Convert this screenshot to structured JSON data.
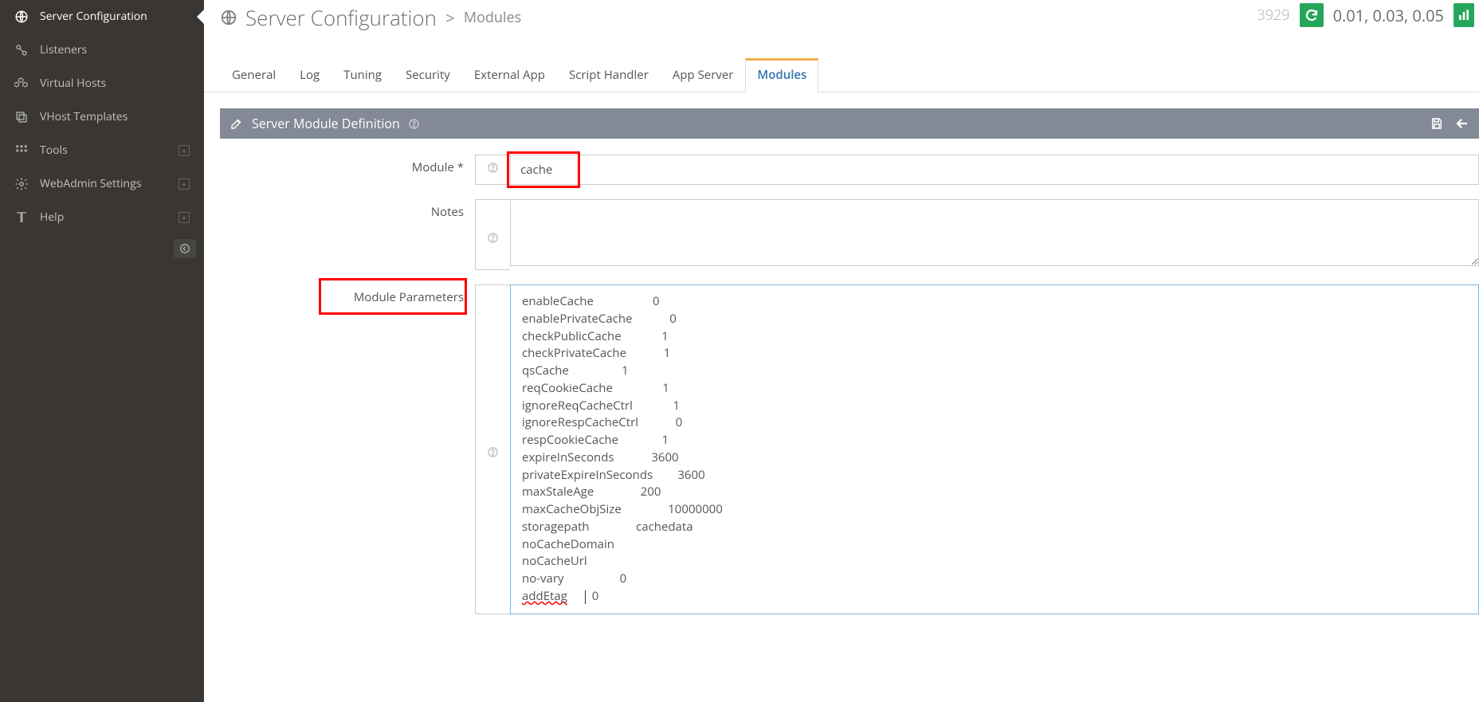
{
  "sidebar": {
    "items": [
      {
        "label": "Server Configuration"
      },
      {
        "label": "Listeners"
      },
      {
        "label": "Virtual Hosts"
      },
      {
        "label": "VHost Templates"
      },
      {
        "label": "Tools"
      },
      {
        "label": "WebAdmin Settings"
      },
      {
        "label": "Help"
      }
    ]
  },
  "breadcrumb": {
    "title": "Server Configuration",
    "crumb": "Modules"
  },
  "stats": {
    "number": "3929",
    "loads": "0.01, 0.03, 0.05"
  },
  "tabs": [
    {
      "label": "General"
    },
    {
      "label": "Log"
    },
    {
      "label": "Tuning"
    },
    {
      "label": "Security"
    },
    {
      "label": "External App"
    },
    {
      "label": "Script Handler"
    },
    {
      "label": "App Server"
    },
    {
      "label": "Modules"
    }
  ],
  "panel": {
    "title": "Server Module Definition"
  },
  "form": {
    "module_label": "Module *",
    "module_value": "cache",
    "notes_label": "Notes",
    "notes_value": "",
    "params_label": "Module Parameters",
    "params_lines": [
      "enableCache                   0",
      "enablePrivateCache            0",
      "checkPublicCache             1",
      "checkPrivateCache            1",
      "qsCache                 1",
      "reqCookieCache                1",
      "ignoreReqCacheCtrl             1",
      "ignoreRespCacheCtrl            0",
      "respCookieCache              1",
      "expireInSeconds            3600",
      "privateExpireInSeconds        3600",
      "maxStaleAge               200",
      "maxCacheObjSize               10000000",
      "storagepath               cachedata",
      "noCacheDomain",
      "noCacheUrl",
      "no-vary                  0"
    ],
    "params_last_key": "addEtag",
    "params_last_val": "0"
  }
}
